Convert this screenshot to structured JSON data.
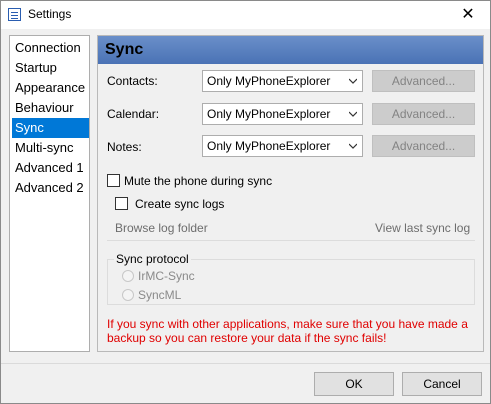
{
  "window": {
    "title": "Settings",
    "close_glyph": "✕"
  },
  "nav": {
    "items": [
      "Connection",
      "Startup",
      "Appearance",
      "Behaviour",
      "Sync",
      "Multi-sync",
      "Advanced 1",
      "Advanced 2"
    ],
    "selected": "Sync"
  },
  "panel": {
    "title": "Sync",
    "contacts": {
      "label": "Contacts:",
      "value": "Only MyPhoneExplorer",
      "advanced": "Advanced..."
    },
    "calendar": {
      "label": "Calendar:",
      "value": "Only MyPhoneExplorer",
      "advanced": "Advanced..."
    },
    "notes": {
      "label": "Notes:",
      "value": "Only MyPhoneExplorer",
      "advanced": "Advanced..."
    },
    "mute_label": "Mute the phone during sync",
    "mute_checked": false,
    "logs": {
      "create_label": "Create sync logs",
      "create_checked": false,
      "browse_label": "Browse log folder",
      "view_label": "View last sync log"
    },
    "protocol": {
      "title": "Sync protocol",
      "options": [
        "IrMC-Sync",
        "SyncML"
      ]
    },
    "warning": "If you sync with other applications, make sure that you have made a backup so you can restore your data if the sync fails!"
  },
  "footer": {
    "ok_label": "OK",
    "cancel_label": "Cancel"
  },
  "colors": {
    "selection": "#0078d7",
    "header": "#5b80bf",
    "warning": "#e00000"
  }
}
